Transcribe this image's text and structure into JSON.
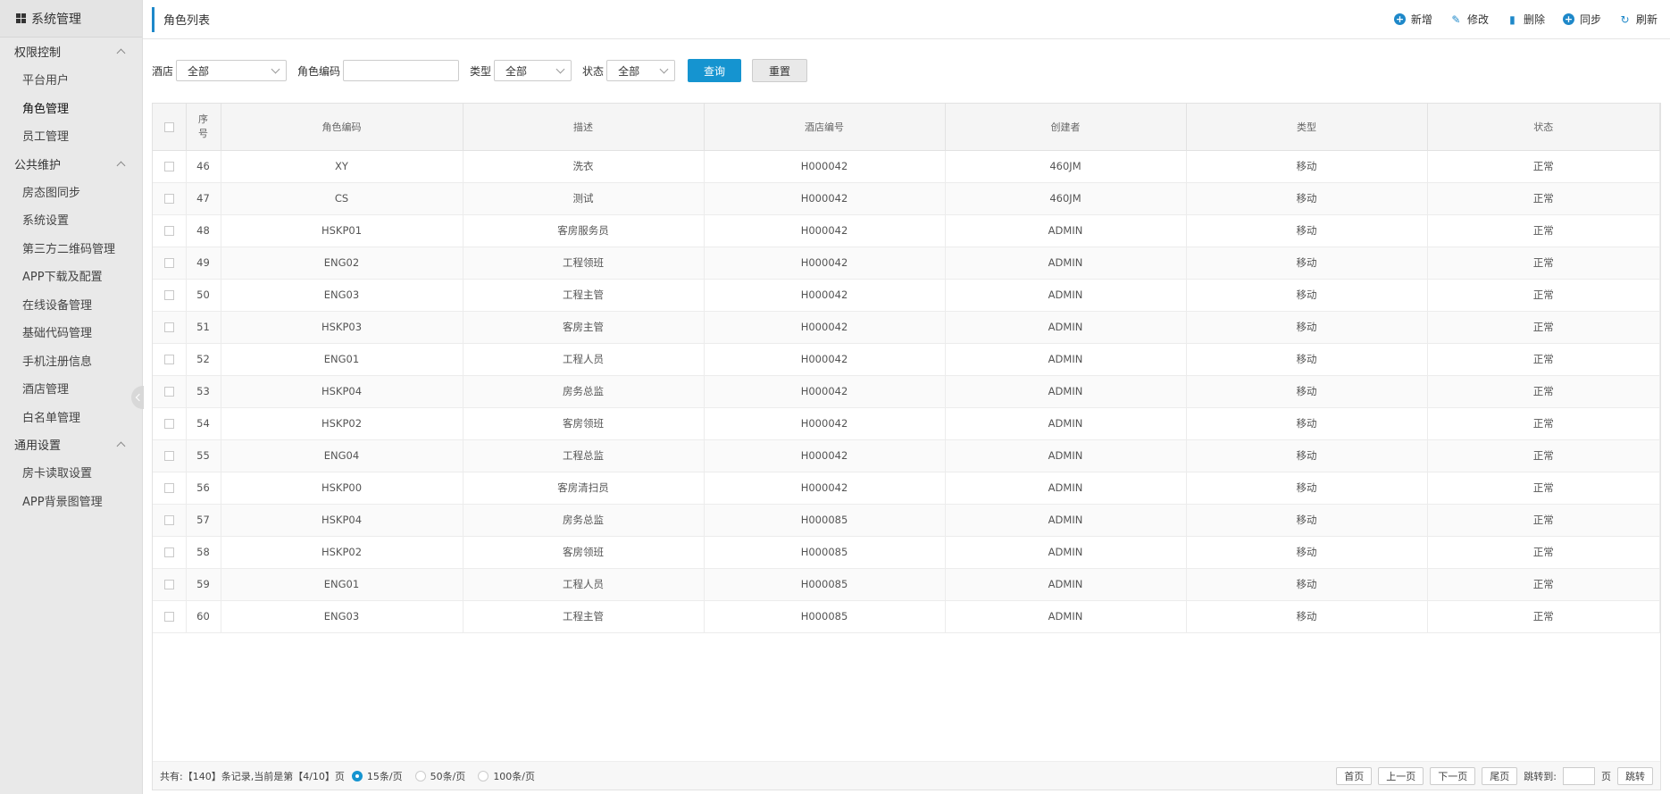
{
  "sidebar": {
    "title": "系统管理",
    "groups": [
      {
        "label": "权限控制",
        "items": [
          "平台用户",
          "角色管理",
          "员工管理"
        ]
      },
      {
        "label": "公共维护",
        "items": [
          "房态图同步",
          "系统设置",
          "第三方二维码管理",
          "APP下载及配置",
          "在线设备管理",
          "基础代码管理",
          "手机注册信息",
          "酒店管理",
          "白名单管理"
        ]
      },
      {
        "label": "通用设置",
        "items": [
          "房卡读取设置",
          "APP背景图管理"
        ]
      }
    ],
    "active_item": "角色管理"
  },
  "header": {
    "title": "角色列表",
    "actions": [
      {
        "label": "新增",
        "icon": "plus-circle-icon"
      },
      {
        "label": "修改",
        "icon": "pencil-icon"
      },
      {
        "label": "删除",
        "icon": "trash-icon"
      },
      {
        "label": "同步",
        "icon": "plus-circle-icon"
      },
      {
        "label": "刷新",
        "icon": "refresh-icon"
      }
    ]
  },
  "filters": {
    "hotel_label": "酒店",
    "hotel_value": "全部",
    "role_code_label": "角色编码",
    "role_code_value": "",
    "type_label": "类型",
    "type_value": "全部",
    "status_label": "状态",
    "status_value": "全部",
    "query_label": "查询",
    "reset_label": "重置"
  },
  "table": {
    "columns": [
      "序号",
      "角色编码",
      "描述",
      "酒店编号",
      "创建者",
      "类型",
      "状态"
    ],
    "rows": [
      [
        "46",
        "XY",
        "洗衣",
        "H000042",
        "460JM",
        "移动",
        "正常"
      ],
      [
        "47",
        "CS",
        "测试",
        "H000042",
        "460JM",
        "移动",
        "正常"
      ],
      [
        "48",
        "HSKP01",
        "客房服务员",
        "H000042",
        "ADMIN",
        "移动",
        "正常"
      ],
      [
        "49",
        "ENG02",
        "工程领班",
        "H000042",
        "ADMIN",
        "移动",
        "正常"
      ],
      [
        "50",
        "ENG03",
        "工程主管",
        "H000042",
        "ADMIN",
        "移动",
        "正常"
      ],
      [
        "51",
        "HSKP03",
        "客房主管",
        "H000042",
        "ADMIN",
        "移动",
        "正常"
      ],
      [
        "52",
        "ENG01",
        "工程人员",
        "H000042",
        "ADMIN",
        "移动",
        "正常"
      ],
      [
        "53",
        "HSKP04",
        "房务总监",
        "H000042",
        "ADMIN",
        "移动",
        "正常"
      ],
      [
        "54",
        "HSKP02",
        "客房领班",
        "H000042",
        "ADMIN",
        "移动",
        "正常"
      ],
      [
        "55",
        "ENG04",
        "工程总监",
        "H000042",
        "ADMIN",
        "移动",
        "正常"
      ],
      [
        "56",
        "HSKP00",
        "客房清扫员",
        "H000042",
        "ADMIN",
        "移动",
        "正常"
      ],
      [
        "57",
        "HSKP04",
        "房务总监",
        "H000085",
        "ADMIN",
        "移动",
        "正常"
      ],
      [
        "58",
        "HSKP02",
        "客房领班",
        "H000085",
        "ADMIN",
        "移动",
        "正常"
      ],
      [
        "59",
        "ENG01",
        "工程人员",
        "H000085",
        "ADMIN",
        "移动",
        "正常"
      ],
      [
        "60",
        "ENG03",
        "工程主管",
        "H000085",
        "ADMIN",
        "移动",
        "正常"
      ]
    ]
  },
  "footer": {
    "summary": "共有:【140】条记录,当前是第【4/10】页",
    "page_sizes": [
      "15条/页",
      "50条/页",
      "100条/页"
    ],
    "selected_page_size": "15条/页",
    "first": "首页",
    "prev": "上一页",
    "next": "下一页",
    "last": "尾页",
    "jump_label": "跳转到:",
    "page_unit": "页",
    "jump_button": "跳转"
  },
  "colors": {
    "accent": "#1594d0",
    "sidebar_bg": "#e9e9e9"
  }
}
